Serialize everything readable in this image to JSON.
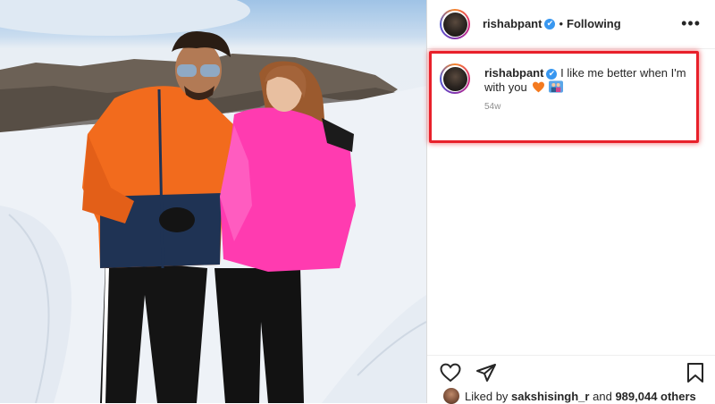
{
  "post": {
    "username": "rishabpant",
    "follow_status": "Following",
    "separator": "•",
    "verified_glyph": "✔",
    "more_glyph": "•••"
  },
  "caption": {
    "username": "rishabpant",
    "text": "I like me better when I'm with you",
    "emojis": [
      "orange-heart-icon",
      "couple-icon"
    ],
    "time": "54w"
  },
  "actions": {
    "icons": [
      "heart-icon",
      "share-icon",
      "bookmark-icon"
    ]
  },
  "likes": {
    "prefix": "Liked by",
    "user": "sakshisingh_r",
    "and_text": "and",
    "count": "989,044 others"
  },
  "colors": {
    "highlight_border": "#e8202a",
    "verified": "#3897f0",
    "orange_jacket": "#f26b1d",
    "pink_coat": "#ff3bb0"
  }
}
